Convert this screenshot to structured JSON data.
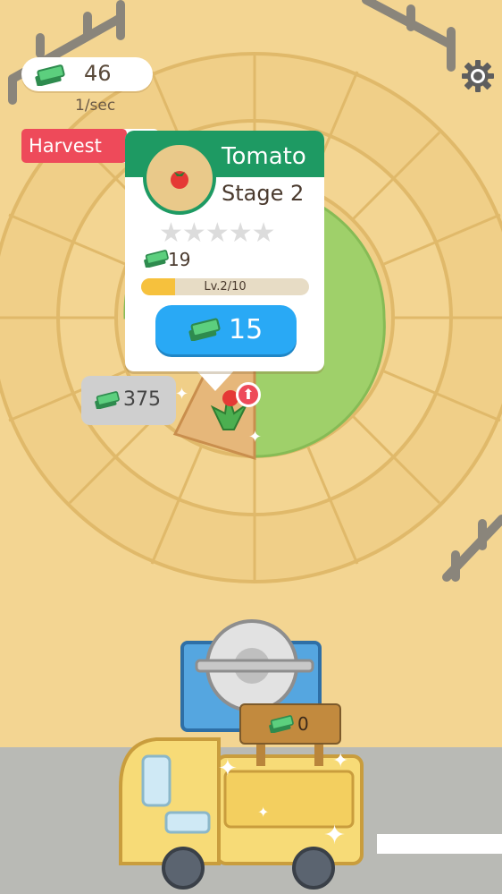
{
  "hud": {
    "cash": "46",
    "rate": "1/sec",
    "harvest_label": "Harvest",
    "plot_price": "375",
    "box_cash": "0",
    "cash_icon": "cash-stack-icon",
    "settings_icon": "gear-icon"
  },
  "popup": {
    "title": "Tomato",
    "stage": "Stage 2",
    "stars_total": 5,
    "stars_filled": 0,
    "income": "19",
    "level_text": "Lv.2/10",
    "level_progress": 0.2,
    "upgrade_cost": "15",
    "crop_icon": "tomato-icon"
  },
  "colors": {
    "ground": "#f3d592",
    "header_green": "#1e9a63",
    "upgrade_blue": "#29a9f5",
    "harvest_red": "#ee4a5a",
    "level_yellow": "#f6c13d",
    "grass": "#9fd06a",
    "truck_yellow": "#f7db77"
  }
}
